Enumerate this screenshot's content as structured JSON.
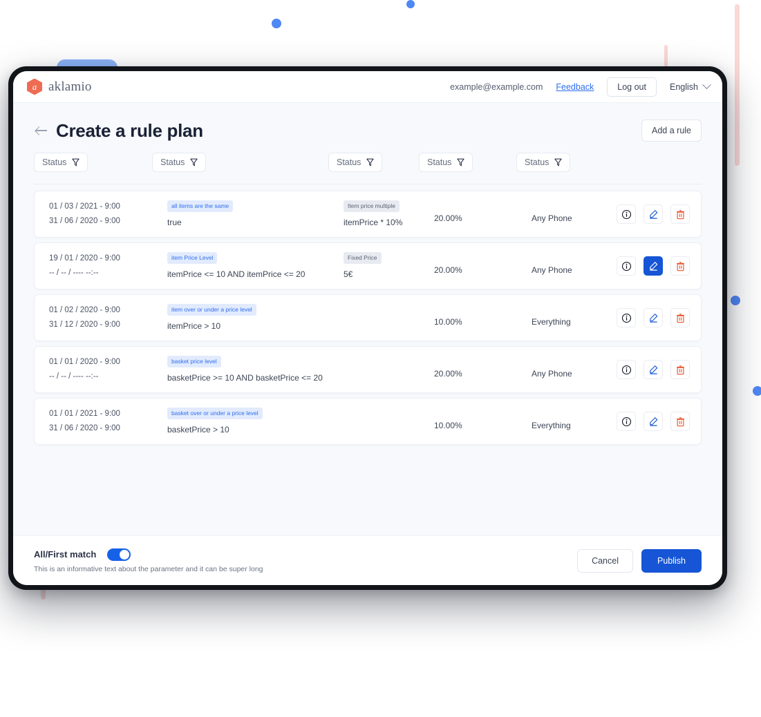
{
  "topbar": {
    "logo_glyph": "a",
    "brand": "aklamio",
    "user_email": "example@example.com",
    "feedback_label": "Feedback",
    "logout_label": "Log out",
    "language": "English"
  },
  "page": {
    "title": "Create a rule plan",
    "add_rule_label": "Add a rule"
  },
  "filters": [
    {
      "label": "Status"
    },
    {
      "label": "Status"
    },
    {
      "label": "Status"
    },
    {
      "label": "Status"
    },
    {
      "label": "Status"
    }
  ],
  "rows": [
    {
      "start_date": "01 / 03 / 2021 - 9:00",
      "end_date": "31 / 06 / 2020 - 9:00",
      "condition_badge": "all items are the same",
      "condition_value": "true",
      "reward_badge": "Item price multiple",
      "reward_value": "itemPrice * 10%",
      "percentage": "20.00%",
      "scope": "Any Phone",
      "edit_active": false
    },
    {
      "start_date": "19 / 01 / 2020 - 9:00",
      "end_date": "-- / -- / ----   --:--",
      "condition_badge": "item Price Level",
      "condition_value": "itemPrice <= 10 AND itemPrice <= 20",
      "reward_badge": "Fixed Price",
      "reward_value": "5€",
      "percentage": "20.00%",
      "scope": "Any Phone",
      "edit_active": true
    },
    {
      "start_date": "01 / 02 / 2020 - 9:00",
      "end_date": "31 / 12 / 2020 - 9:00",
      "condition_badge": "item over or under a price level",
      "condition_value": "itemPrice > 10",
      "reward_badge": "",
      "reward_value": "",
      "percentage": "10.00%",
      "scope": "Everything",
      "edit_active": false
    },
    {
      "start_date": "01 / 01 / 2020 - 9:00",
      "end_date": "-- / -- / ----   --:--",
      "condition_badge": "basket price level",
      "condition_value": "basketPrice >= 10 AND basketPrice <= 20",
      "reward_badge": "",
      "reward_value": "",
      "percentage": "20.00%",
      "scope": "Any Phone",
      "edit_active": false
    },
    {
      "start_date": "01 / 01 / 2021 - 9:00",
      "end_date": "31 / 06 / 2020 - 9:00",
      "condition_badge": "basket over or under a price level",
      "condition_value": "basketPrice > 10",
      "reward_badge": "",
      "reward_value": "",
      "percentage": "10.00%",
      "scope": "Everything",
      "edit_active": false
    }
  ],
  "row_actions": {
    "info_name": "info-icon",
    "edit_name": "edit-icon",
    "delete_name": "delete-icon"
  },
  "footer": {
    "toggle_label": "All/First match",
    "toggle_on": true,
    "help_text": "This is an informative text about the parameter and it can be super long",
    "cancel_label": "Cancel",
    "publish_label": "Publish"
  },
  "colors": {
    "accent_blue": "#1656d6",
    "link_blue": "#2f6ef0",
    "logo_orange": "#ef6c52",
    "delete_red": "#e8502a",
    "deco_blue": "#4f87f5",
    "deco_pink": "#fbd9d6"
  }
}
